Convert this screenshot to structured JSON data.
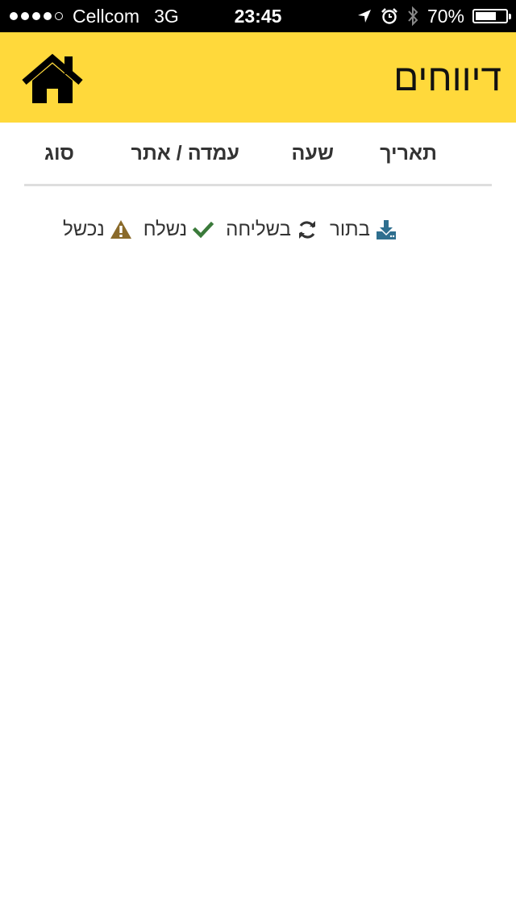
{
  "status_bar": {
    "carrier": "Cellcom",
    "network": "3G",
    "time": "23:45",
    "battery": "70%",
    "battery_level": 0.7,
    "signal_bars": 4,
    "signal_total": 5
  },
  "header": {
    "title": "דיווחים",
    "home_icon": "home-icon",
    "background": "#ffd93b"
  },
  "table": {
    "columns": [
      "תאריך",
      "שעה",
      "עמדה / אתר",
      "סוג"
    ]
  },
  "legend": [
    {
      "label": "בתור",
      "icon": "download-icon",
      "color": "#2f6f8f"
    },
    {
      "label": "בשליחה",
      "icon": "refresh-icon",
      "color": "#333333"
    },
    {
      "label": "נשלח",
      "icon": "check-icon",
      "color": "#3a7a3a"
    },
    {
      "label": "נכשל",
      "icon": "warning-icon",
      "color": "#8a6a2a"
    }
  ]
}
